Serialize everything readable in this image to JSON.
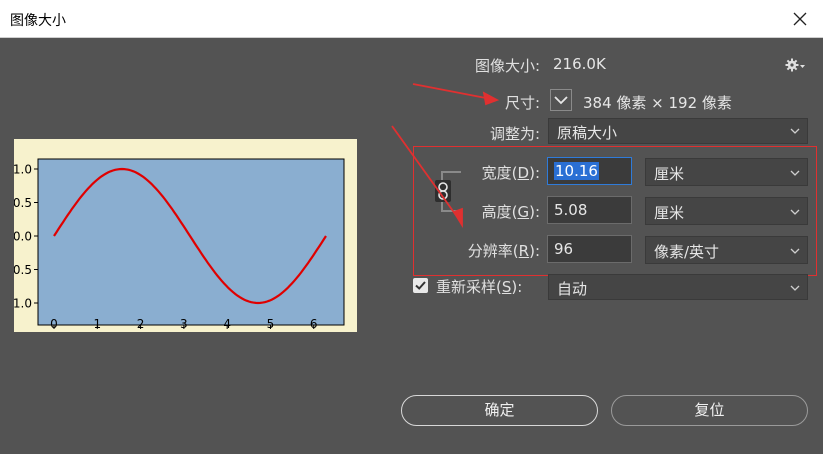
{
  "window": {
    "title": "图像大小"
  },
  "info": {
    "image_size_label": "图像大小:",
    "image_size_value": "216.0K",
    "dimensions_label": "尺寸:",
    "dimensions_value": "384 像素  ×  192 像素"
  },
  "fit_to": {
    "label": "调整为:",
    "value": "原稿大小"
  },
  "fields": {
    "width": {
      "label_pre": "宽度(",
      "hotkey": "D",
      "label_post": "):",
      "value": "10.16",
      "unit": "厘米"
    },
    "height": {
      "label_pre": "高度(",
      "hotkey": "G",
      "label_post": "):",
      "value": "5.08",
      "unit": "厘米"
    },
    "resolution": {
      "label_pre": "分辨率(",
      "hotkey": "R",
      "label_post": "):",
      "value": "96",
      "unit": "像素/英寸"
    }
  },
  "resample": {
    "label_pre": "重新采样(",
    "hotkey": "S",
    "label_post": "):",
    "value": "自动",
    "checked": true
  },
  "buttons": {
    "ok": "确定",
    "reset": "复位"
  },
  "preview_chart": {
    "y_tick_labels": [
      ".1.0",
      "0.5",
      "0.0",
      "0.5",
      ".1.0"
    ],
    "x_tick_labels": [
      "0",
      "1",
      "2",
      "3",
      "4",
      "5",
      "6"
    ],
    "line_color": "#e00000",
    "plot_bg": "#8aaed0",
    "figure_bg": "#f7f2cd"
  },
  "annotation_color": "#e03030"
}
